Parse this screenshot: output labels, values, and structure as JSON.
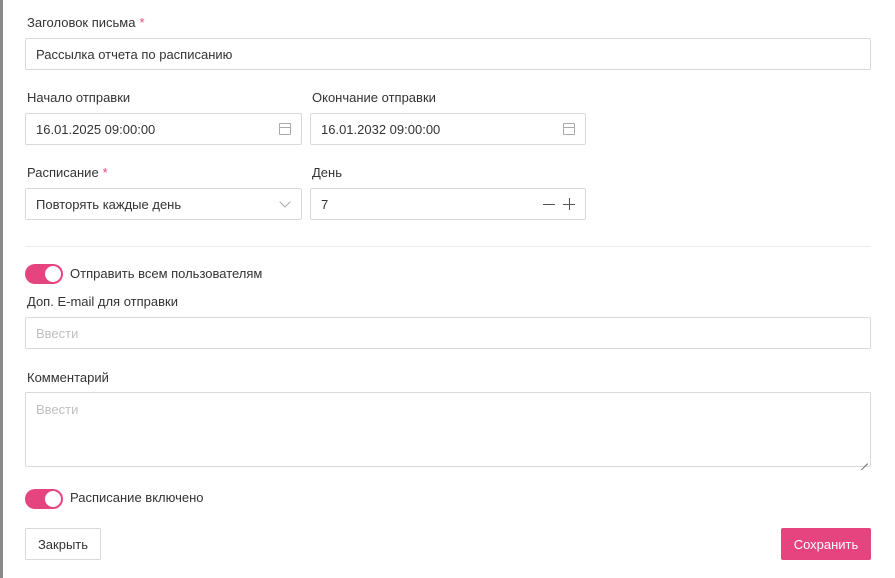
{
  "form": {
    "subject": {
      "label": "Заголовок письма",
      "required_mark": "*",
      "value": "Рассылка отчета по расписанию"
    },
    "start": {
      "label": "Начало отправки",
      "value": "16.01.2025 09:00:00",
      "icon": "calendar-icon"
    },
    "end": {
      "label": "Окончание отправки",
      "value": "16.01.2032 09:00:00",
      "icon": "calendar-icon"
    },
    "schedule": {
      "label": "Расписание",
      "required_mark": "*",
      "value": "Повторять каждые день"
    },
    "day": {
      "label": "День",
      "value": "7"
    },
    "send_all": {
      "label": "Отправить всем пользователям",
      "on": true
    },
    "extra_email": {
      "label": "Доп. E-mail для отправки",
      "placeholder": "Ввести"
    },
    "comment": {
      "label": "Комментарий",
      "placeholder": "Ввести"
    },
    "schedule_enabled": {
      "label": "Расписание включено",
      "on": true
    }
  },
  "footer": {
    "close_label": "Закрыть",
    "save_label": "Сохранить"
  },
  "colors": {
    "accent": "#e5447f",
    "border": "#d9d9d9",
    "placeholder": "#bfbfbf"
  }
}
